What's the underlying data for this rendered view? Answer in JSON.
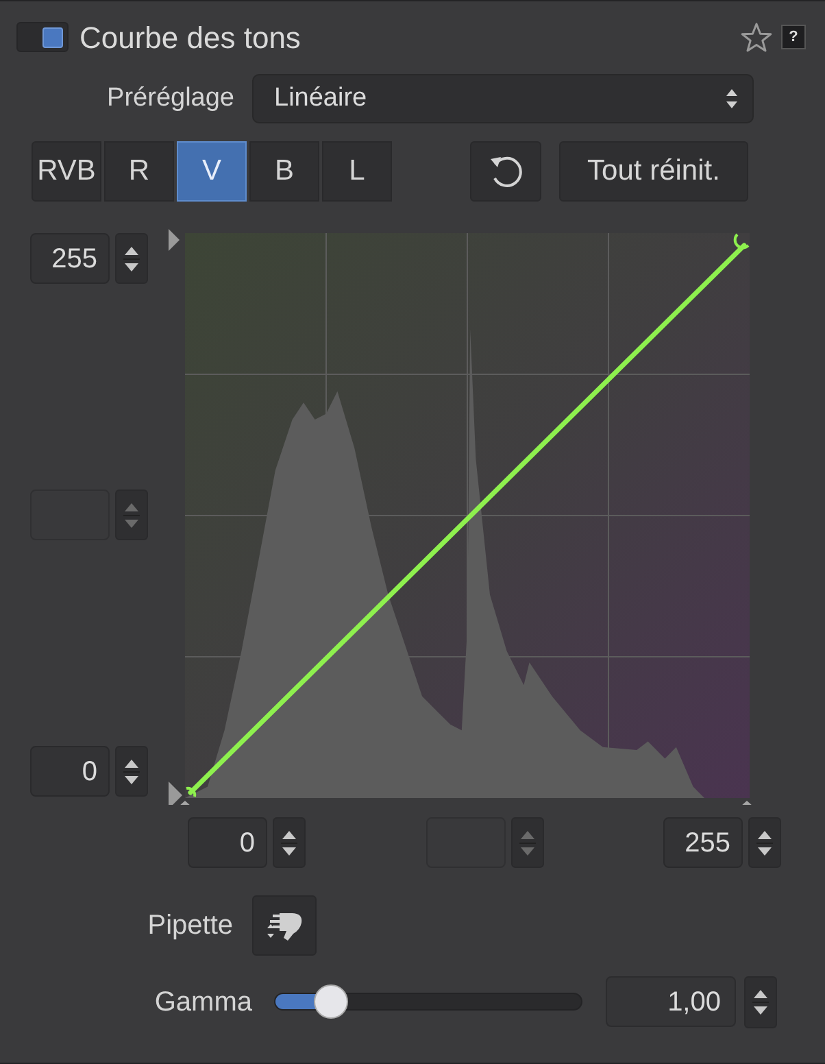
{
  "header": {
    "title": "Courbe des tons",
    "enabled": true,
    "starred": false,
    "help": "?"
  },
  "preset": {
    "label": "Préréglage",
    "value": "Linéaire"
  },
  "channels": [
    {
      "label": "RVB",
      "selected": false
    },
    {
      "label": "R",
      "selected": false
    },
    {
      "label": "V",
      "selected": true
    },
    {
      "label": "B",
      "selected": false
    },
    {
      "label": "L",
      "selected": false
    }
  ],
  "reset_all": "Tout réinit.",
  "output_fields": [
    {
      "value": "255",
      "disabled": false
    },
    {
      "disabled": true
    },
    {
      "value": "0",
      "disabled": false
    }
  ],
  "input_fields": [
    {
      "value": "0",
      "disabled": false
    },
    {
      "disabled": true
    },
    {
      "value": "255",
      "disabled": false
    }
  ],
  "pipette": {
    "label": "Pipette"
  },
  "gamma": {
    "label": "Gamma",
    "level": 0.18,
    "value": "1,00"
  }
}
